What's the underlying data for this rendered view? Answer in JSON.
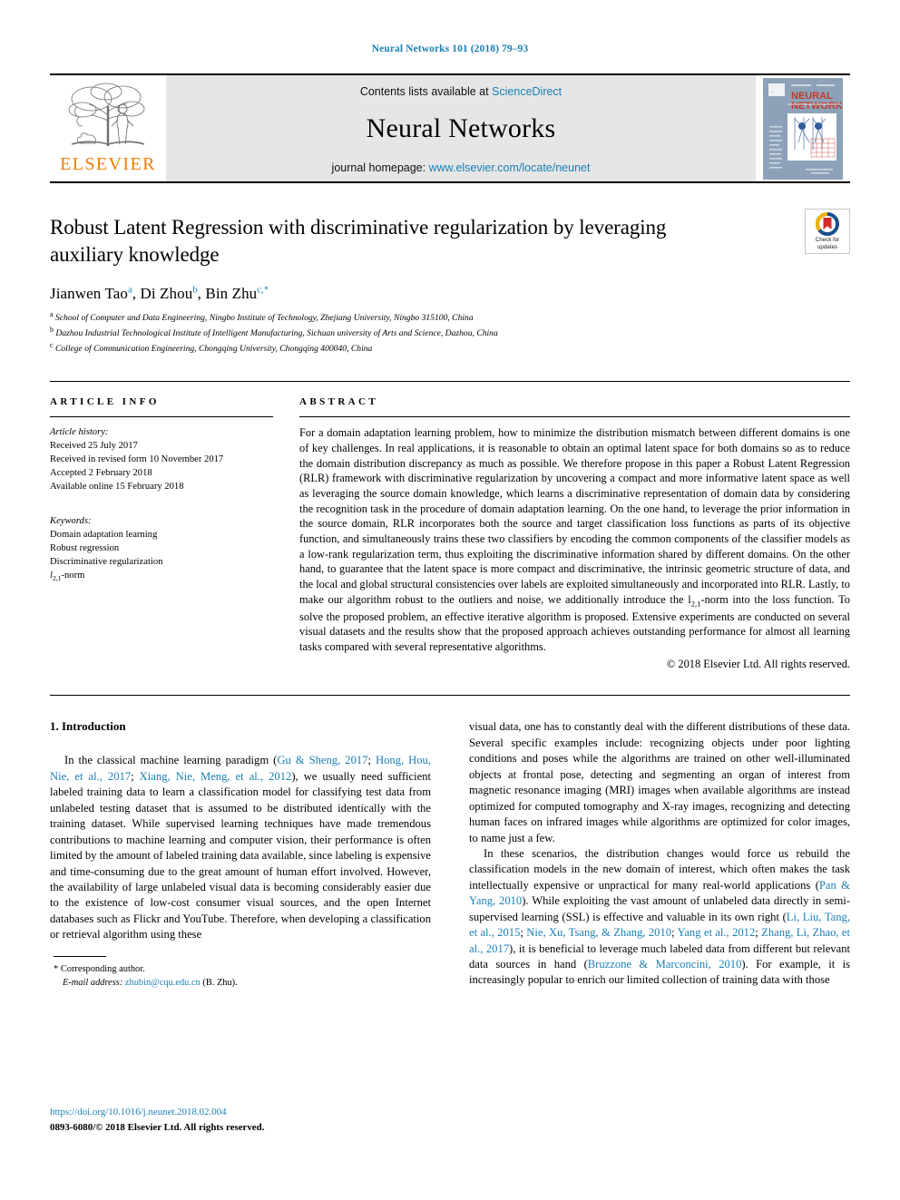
{
  "running_head": "Neural Networks 101 (2018) 79–93",
  "masthead": {
    "contents_prefix": "Contents lists available at ",
    "contents_link": "ScienceDirect",
    "journal_name": "Neural Networks",
    "homepage_prefix": "journal homepage: ",
    "homepage_link": "www.elsevier.com/locate/neunet",
    "publisher_wordmark": "ELSEVIER",
    "cover_title_line1": "NEURAL",
    "cover_title_line2": "NETWORKS"
  },
  "title": "Robust Latent Regression with discriminative regularization by leveraging auxiliary knowledge",
  "authors": [
    {
      "name": "Jianwen Tao",
      "mark": "a"
    },
    {
      "name": "Di Zhou",
      "mark": "b"
    },
    {
      "name": "Bin Zhu",
      "mark": "c,*"
    }
  ],
  "affiliations": [
    {
      "mark": "a",
      "text": "School of Computer and Data Engineering, Ningbo Institute of Technology, Zhejiang University, Ningbo 315100, China"
    },
    {
      "mark": "b",
      "text": "Dazhou Industrial Technological Institute of Intelligent Manufacturing, Sichuan university of Arts and Science, Dazhou, China"
    },
    {
      "mark": "c",
      "text": "College of Communication Engineering, Chongqing University, Chongqing 400040, China"
    }
  ],
  "crossmark": {
    "line1": "Check for",
    "line2": "updates"
  },
  "article_info": {
    "heading": "ARTICLE INFO",
    "history_label": "Article history:",
    "history": [
      "Received 25 July 2017",
      "Received in revised form 10 November 2017",
      "Accepted 2 February 2018",
      "Available online 15 February 2018"
    ],
    "keywords_label": "Keywords:",
    "keywords": [
      "Domain adaptation learning",
      "Robust regression",
      "Discriminative regularization"
    ],
    "keyword_norm_prefix": "l",
    "keyword_norm_sub": "2,1",
    "keyword_norm_suffix": "-norm"
  },
  "abstract": {
    "heading": "ABSTRACT",
    "part1": "For a domain adaptation learning problem, how to minimize the distribution mismatch between different domains is one of key challenges. In real applications, it is reasonable to obtain an optimal latent space for both domains so as to reduce the domain distribution discrepancy as much as possible. We therefore propose in this paper a Robust Latent Regression (RLR) framework with discriminative regularization by uncovering a compact and more informative latent space as well as leveraging the source domain knowledge, which learns a discriminative representation of domain data by considering the recognition task in the procedure of domain adaptation learning. On the one hand, to leverage the prior information in the source domain, RLR incorporates both the source and target classification loss functions as parts of its objective function, and simultaneously trains these two classifiers by encoding the common components of the classifier models as a low-rank regularization term, thus exploiting the discriminative information shared by different domains. On the other hand, to guarantee that the latent space is more compact and discriminative, the intrinsic geometric structure of data, and the local and global structural consistencies over labels are exploited simultaneously and incorporated into RLR. Lastly, to make our algorithm robust to the outliers and noise, we additionally introduce the l",
    "norm_sub": "2,1",
    "part2": "-norm into the loss function. To solve the proposed problem, an effective iterative algorithm is proposed. Extensive experiments are conducted on several visual datasets and the results show that the proposed approach achieves outstanding performance for almost all learning tasks compared with several representative algorithms.",
    "copyright": "© 2018 Elsevier Ltd. All rights reserved."
  },
  "section_heading": "1. Introduction",
  "intro_left": {
    "p1_a": "In the classical machine learning paradigm (",
    "p1_c1": "Gu & Sheng, 2017",
    "p1_b": "; ",
    "p1_c2": "Hong, Hou, Nie, et al., 2017",
    "p1_c": "; ",
    "p1_c3": "Xiang, Nie, Meng, et al., 2012",
    "p1_d": "), we usually need sufficient labeled training data to learn a classification model for classifying test data from unlabeled testing dataset that is assumed to be distributed identically with the training dataset. While supervised learning techniques have made tremendous contributions to machine learning and computer vision, their performance is often limited by the amount of labeled training data available, since labeling is expensive and time-consuming due to the great amount of human effort involved. However, the availability of large unlabeled visual data is becoming considerably easier due to the existence of low-cost consumer visual sources, and the open Internet databases such as Flickr and YouTube. Therefore, when developing a classification or retrieval algorithm using these"
  },
  "intro_right": {
    "p1_cont": "visual data, one has to constantly deal with the different distributions of these data. Several specific examples include: recognizing objects under poor lighting conditions and poses while the algorithms are trained on other well-illuminated objects at frontal pose, detecting and segmenting an organ of interest from magnetic resonance imaging (MRI) images when available algorithms are instead optimized for computed tomography and X-ray images, recognizing and detecting human faces on infrared images while algorithms are optimized for color images, to name just a few.",
    "p2_a": "In these scenarios, the distribution changes would force us rebuild the classification models in the new domain of interest, which often makes the task intellectually expensive or unpractical for many real-world applications (",
    "p2_c1": "Pan & Yang, 2010",
    "p2_b": "). While exploiting the vast amount of unlabeled data directly in semi-supervised learning (SSL) is effective and valuable in its own right (",
    "p2_c2": "Li, Liu, Tang, et al., 2015",
    "p2_c": "; ",
    "p2_c3": "Nie, Xu, Tsang, & Zhang, 2010",
    "p2_d": "; ",
    "p2_c4": "Yang et al., 2012",
    "p2_e": "; ",
    "p2_c5": "Zhang, Li, Zhao, et al., 2017",
    "p2_f": "), it is beneficial to leverage much labeled data from different but relevant data sources in hand (",
    "p2_c6": "Bruzzone & Marconcini, 2010",
    "p2_g": "). For example, it is increasingly popular to enrich our limited collection of training data with those"
  },
  "footnote": {
    "marker": "*",
    "corresponding": "Corresponding author.",
    "email_label": "E-mail address:",
    "email": "zhubin@cqu.edu.cn",
    "email_suffix": "(B. Zhu)."
  },
  "bottom": {
    "doi": "https://doi.org/10.1016/j.neunet.2018.02.004",
    "issn_line": "0893-6080/© 2018 Elsevier Ltd. All rights reserved."
  },
  "colors": {
    "link": "#1a7fb5",
    "elsevier_orange": "#f07d00",
    "masthead_bg": "#e6e6e6"
  }
}
